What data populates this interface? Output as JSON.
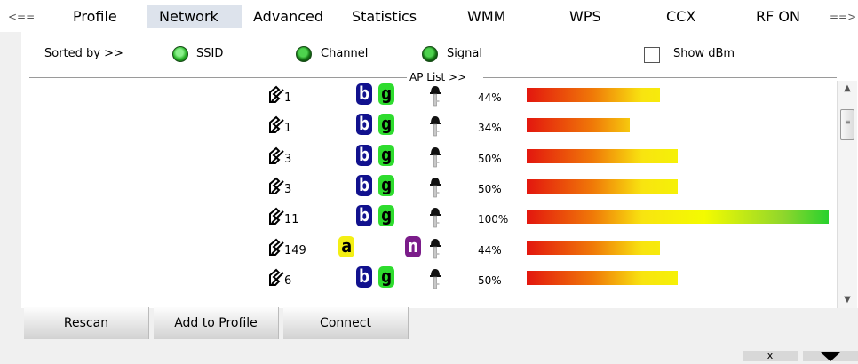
{
  "tabs": [
    {
      "label": "<==",
      "active": false
    },
    {
      "label": "Profile",
      "active": false
    },
    {
      "label": "Network",
      "active": true
    },
    {
      "label": "Advanced",
      "active": false
    },
    {
      "label": "Statistics",
      "active": false
    },
    {
      "label": "WMM",
      "active": false
    },
    {
      "label": "WPS",
      "active": false
    },
    {
      "label": "CCX",
      "active": false
    },
    {
      "label": "RF ON",
      "active": false
    },
    {
      "label": "==>",
      "active": false
    }
  ],
  "sort": {
    "label": "Sorted by >>",
    "options": [
      "SSID",
      "Channel",
      "Signal"
    ],
    "selected": "SSID",
    "show_dbm_label": "Show dBm",
    "show_dbm_checked": false
  },
  "ap_list": {
    "title": "AP List >>",
    "rows": [
      {
        "channel": "1",
        "modes": [
          "b",
          "g"
        ],
        "encrypted": true,
        "signal_label": "44%",
        "signal": 44
      },
      {
        "channel": "1",
        "modes": [
          "b",
          "g"
        ],
        "encrypted": true,
        "signal_label": "34%",
        "signal": 34
      },
      {
        "channel": "3",
        "modes": [
          "b",
          "g"
        ],
        "encrypted": true,
        "signal_label": "50%",
        "signal": 50
      },
      {
        "channel": "3",
        "modes": [
          "b",
          "g"
        ],
        "encrypted": true,
        "signal_label": "50%",
        "signal": 50
      },
      {
        "channel": "11",
        "modes": [
          "b",
          "g"
        ],
        "encrypted": true,
        "signal_label": "100%",
        "signal": 100
      },
      {
        "channel": "149",
        "modes": [
          "a",
          "n"
        ],
        "encrypted": true,
        "signal_label": "44%",
        "signal": 44
      },
      {
        "channel": "6",
        "modes": [
          "b",
          "g"
        ],
        "encrypted": true,
        "signal_label": "50%",
        "signal": 50
      }
    ]
  },
  "buttons": {
    "rescan": "Rescan",
    "add_to_profile": "Add to Profile",
    "connect": "Connect"
  },
  "window_controls": {
    "close": "x",
    "collapse_icon": "triangle-down-icon"
  },
  "colors": {
    "active_tab_bg": "#dde3ec",
    "radio_green": "#2bb52b",
    "badge_b": "#11118e",
    "badge_g": "#2edc2e",
    "badge_a": "#f4ef14",
    "badge_n": "#7b1d8a"
  }
}
